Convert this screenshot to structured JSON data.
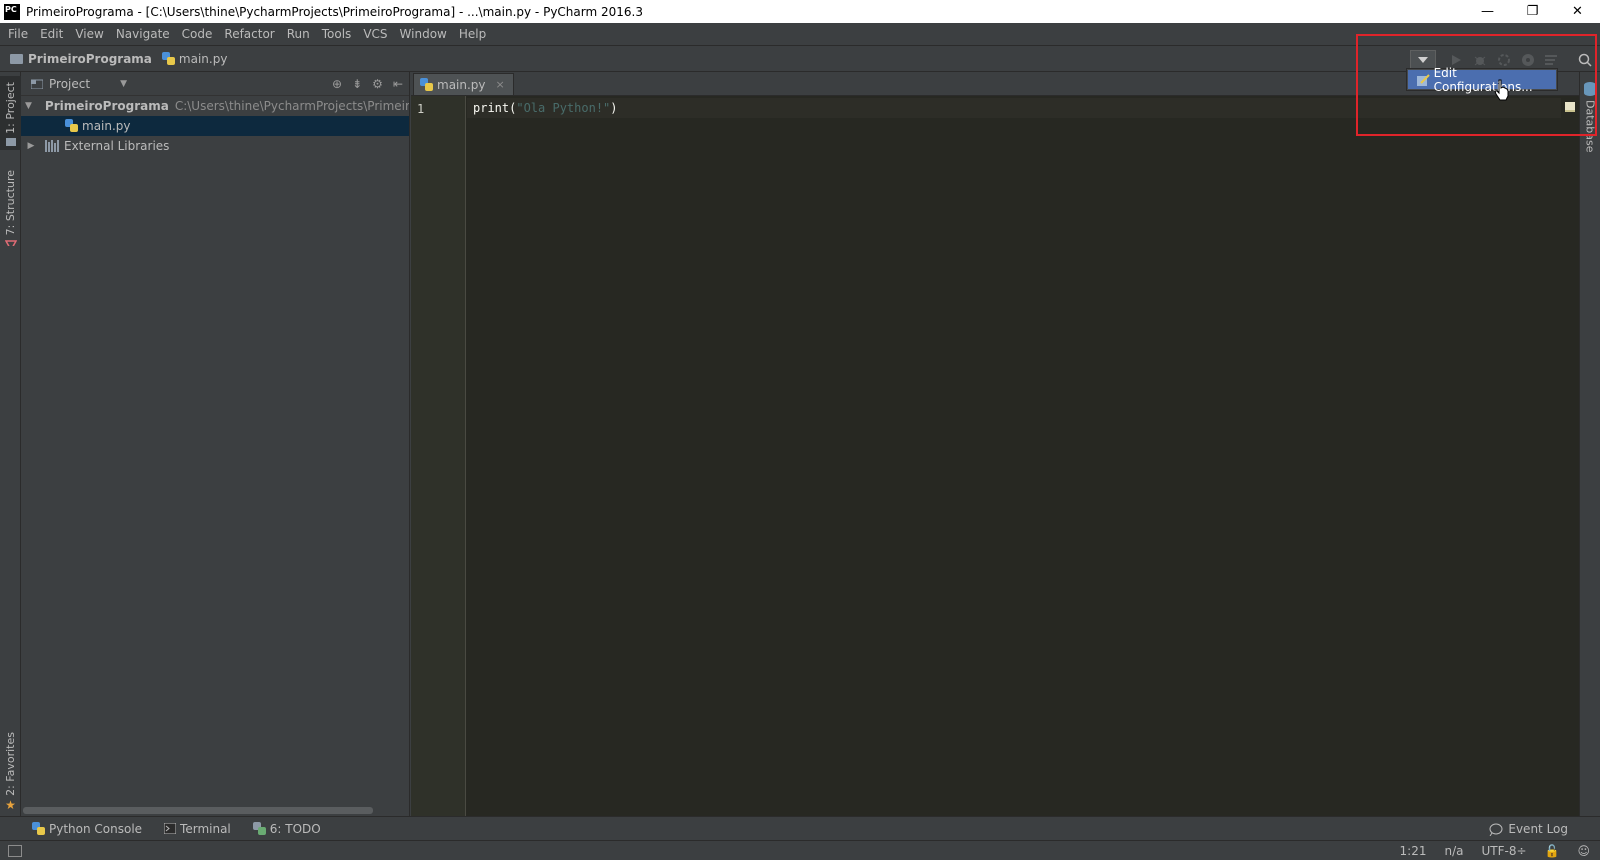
{
  "window": {
    "app_icon": "PC",
    "title": "PrimeiroPrograma - [C:\\Users\\thine\\PycharmProjects\\PrimeiroPrograma] - ...\\main.py - PyCharm 2016.3",
    "minimize": "—",
    "restore": "❐",
    "close": "✕"
  },
  "menu": [
    "File",
    "Edit",
    "View",
    "Navigate",
    "Code",
    "Refactor",
    "Run",
    "Tools",
    "VCS",
    "Window",
    "Help"
  ],
  "navbar": {
    "project": "PrimeiroPrograma",
    "file": "main.py"
  },
  "popup": {
    "item": "Edit Configurations..."
  },
  "left_tabs": {
    "project": "1: Project",
    "structure": "7: Structure",
    "favorites": "2: Favorites"
  },
  "project_panel": {
    "view": "Project",
    "root": {
      "name": "PrimeiroPrograma",
      "path": "C:\\Users\\thine\\PycharmProjects\\PrimeiroProg"
    },
    "file": "main.py",
    "libraries": "External Libraries"
  },
  "editor": {
    "tab": "main.py",
    "line_number": "1",
    "code_func": "print(",
    "code_string": "\"Ola Python!\"",
    "code_close": ")"
  },
  "right_tabs": {
    "database": "Database"
  },
  "bottom_tools": {
    "python_console": "Python Console",
    "terminal": "Terminal",
    "todo": "6: TODO",
    "event_log": "Event Log"
  },
  "status": {
    "position": "1:21",
    "line_sep": "n/a",
    "encoding": "UTF-8÷"
  }
}
